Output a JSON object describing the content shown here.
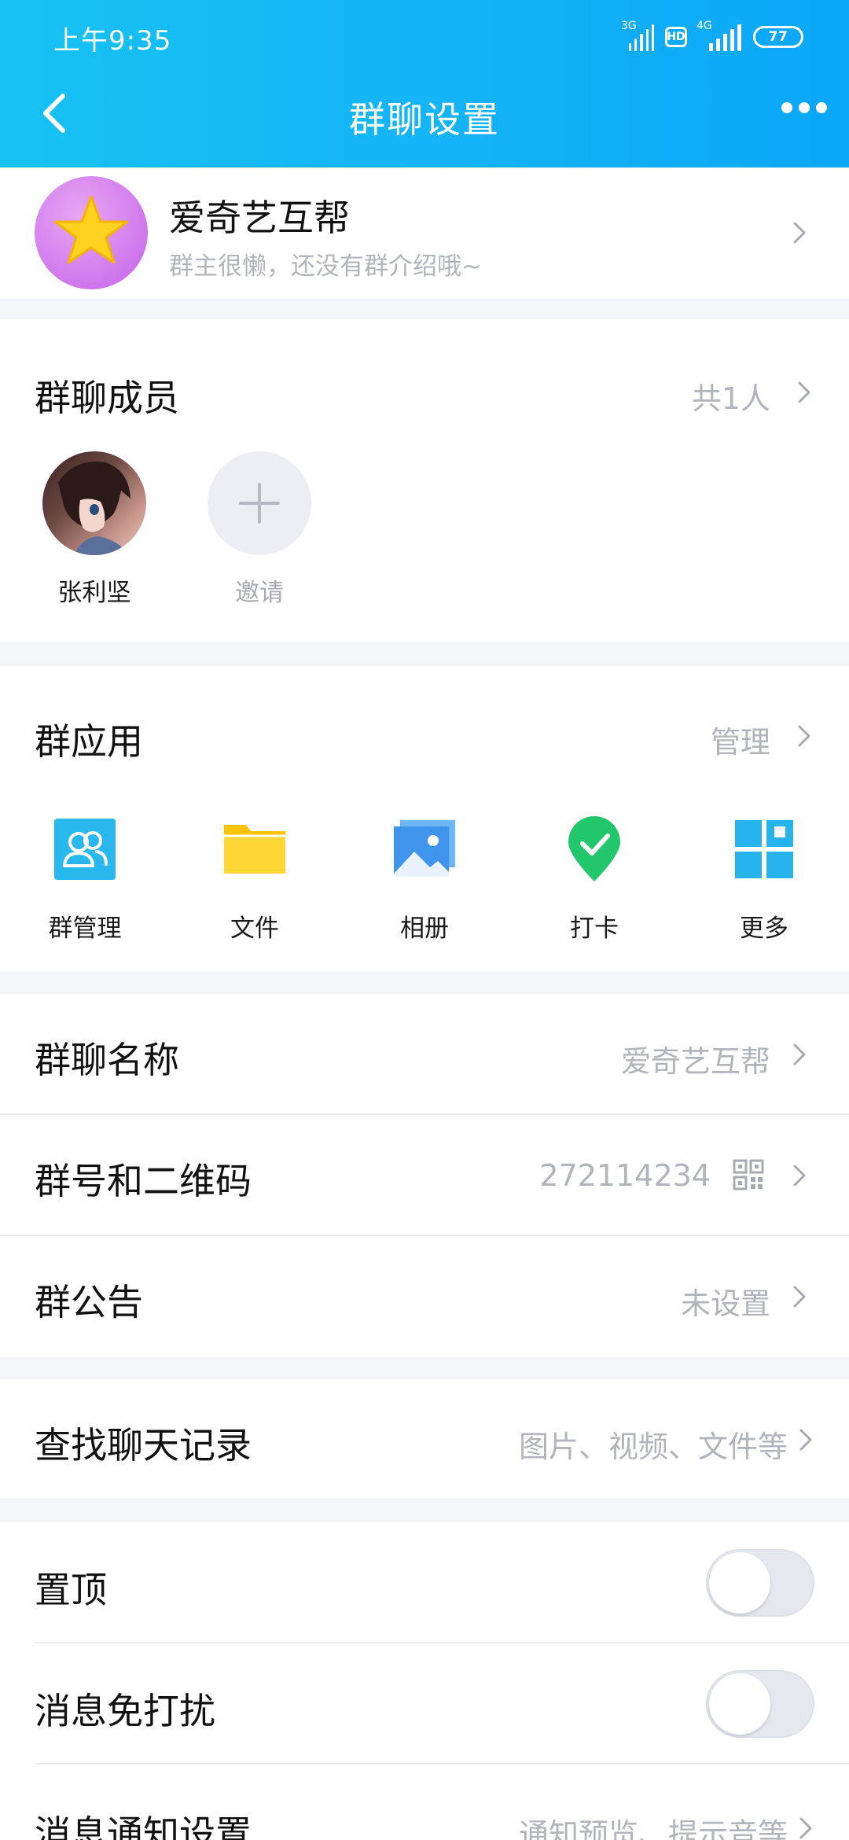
{
  "status_bar": {
    "time": "上午9:35",
    "net1": "3G",
    "net2": "4G",
    "hd": "HD",
    "battery": "77"
  },
  "nav": {
    "title": "群聊设置"
  },
  "group": {
    "name": "爱奇艺互帮",
    "intro": "群主很懒，还没有群介绍哦~"
  },
  "members": {
    "title": "群聊成员",
    "count": "共1人",
    "list": [
      {
        "name": "张利坚"
      }
    ],
    "invite_label": "邀请"
  },
  "apps": {
    "title": "群应用",
    "manage": "管理",
    "items": [
      {
        "label": "群管理",
        "icon": "group-manage-icon"
      },
      {
        "label": "文件",
        "icon": "folder-icon"
      },
      {
        "label": "相册",
        "icon": "album-icon"
      },
      {
        "label": "打卡",
        "icon": "checkin-icon"
      },
      {
        "label": "更多",
        "icon": "more-grid-icon"
      }
    ]
  },
  "info": {
    "name_label": "群聊名称",
    "name_value": "爱奇艺互帮",
    "number_label": "群号和二维码",
    "number_value": "272114234",
    "notice_label": "群公告",
    "notice_value": "未设置"
  },
  "search": {
    "label": "查找聊天记录",
    "value": "图片、视频、文件等"
  },
  "settings": {
    "pin_label": "置顶",
    "pin_on": false,
    "mute_label": "消息免打扰",
    "mute_on": false,
    "notify_label": "消息通知设置",
    "notify_value": "通知预览、提示音等"
  },
  "colors": {
    "header_start": "#16c2f4",
    "header_end": "#0aa6f7",
    "gray_text": "#b2b4bb"
  }
}
